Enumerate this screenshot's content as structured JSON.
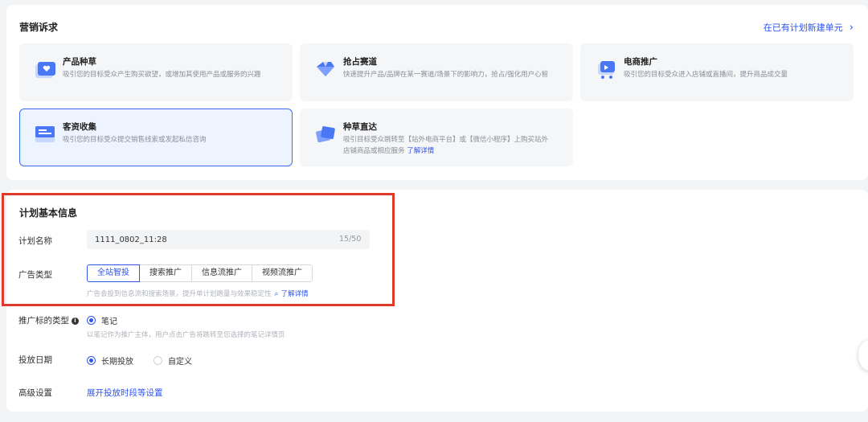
{
  "marketing": {
    "title": "营销诉求",
    "new_unit_link": "在已有计划新建单元",
    "cards": [
      {
        "title": "产品种草",
        "desc": "吸引您的目标受众产生购买欲望，或增加其使用产品或服务的兴趣",
        "icon": "heart-box-icon"
      },
      {
        "title": "抢占赛道",
        "desc": "快速提升产品/品牌在某一赛道/场景下的影响力，抢占/强化用户心智",
        "icon": "diamond-icon"
      },
      {
        "title": "电商推广",
        "desc": "吸引您的目标受众进入店铺或直播间，提升商品成交量",
        "icon": "cart-icon"
      },
      {
        "title": "客资收集",
        "desc": "吸引您的目标受众提交销售线索或发起私信咨询",
        "icon": "form-icon"
      },
      {
        "title": "种草直达",
        "desc_line1": "吸引目标受众跳转至【站外电商平台】或【微信小程序】上购买站外",
        "desc_line2": "店铺商品或相应服务",
        "more": "了解详情",
        "icon": "card-stack-icon"
      }
    ]
  },
  "plan": {
    "title": "计划基本信息",
    "name_label": "计划名称",
    "name_value": "1111_0802_11:28",
    "name_count": "15/50",
    "ad_type_label": "广告类型",
    "ad_types": [
      "全站智投",
      "搜索推广",
      "信息流推广",
      "视频流推广"
    ],
    "ad_type_hint": "广告会投到信息流和搜索场景，提升单计划跑量与效果稳定性",
    "ad_type_hint_link": "了解详情",
    "target_type_label": "推广标的类型",
    "target_type_option": "笔记",
    "target_type_hint": "以笔记作为推广主体，用户点击广告将跳转至您选择的笔记详情页",
    "date_label": "投放日期",
    "date_options": [
      "长期投放",
      "自定义"
    ],
    "advanced_label": "高级设置",
    "advanced_link": "展开投放时段等设置"
  },
  "colors": {
    "accent": "#2f54eb",
    "highlight_box": "#e03a2a"
  }
}
